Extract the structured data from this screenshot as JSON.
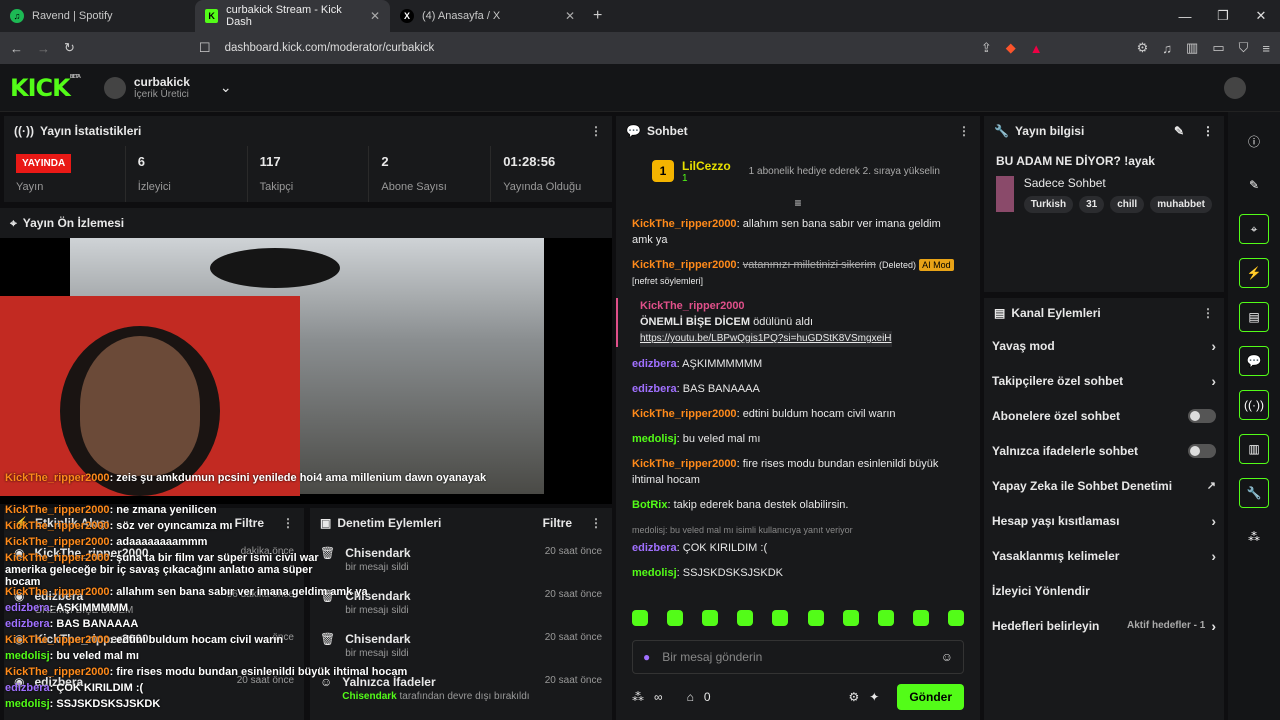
{
  "browser": {
    "tabs": [
      {
        "title": "Ravend | Spotify",
        "icon": "spotify-icon"
      },
      {
        "title": "curbakick Stream - Kick Dash",
        "icon": "kick-icon"
      },
      {
        "title": "(4) Anasayfa / X",
        "icon": "x-icon"
      }
    ],
    "url": "dashboard.kick.com/moderator/curbakick"
  },
  "header": {
    "logo": "KICK",
    "logo_badge": "BETA",
    "channel_name": "curbakick",
    "channel_role": "İçerik Üretici"
  },
  "stats": {
    "title": "Yayın İstatistikleri",
    "live_badge": "YAYINDA",
    "live_label": "Yayın",
    "items": [
      {
        "value": "6",
        "label": "İzleyici"
      },
      {
        "value": "117",
        "label": "Takipçi"
      },
      {
        "value": "2",
        "label": "Abone Sayısı"
      },
      {
        "value": "01:28:56",
        "label": "Yayında Olduğu"
      }
    ]
  },
  "preview": {
    "title": "Yayın Ön İzlemesi",
    "overlay_chat": [
      {
        "user": "KickThe_ripper2000",
        "text": "zeis şu amkdumun pcsini yenilede hoi4 ama millenium dawn oyanayak"
      },
      {
        "user": "KickThe_ripper2000",
        "text": "ne zmana yenilicen"
      },
      {
        "user": "KickThe_ripper2000",
        "text": "söz ver oyıncamıza mı"
      },
      {
        "user": "KickThe_ripper2000",
        "text": "adaaaaaaaammm"
      },
      {
        "user": "KickThe_ripper2000",
        "text": "şuna ta bir film var süper ismi civil war amerika geleceğe bir iç savaş çıkacağını anlatıo ama süper hocam"
      },
      {
        "user": "KickThe_ripper2000",
        "text": "allahım sen bana sabır ver imana geldim amk ya"
      },
      {
        "user": "edizbera",
        "text": "AŞKIMMMMM"
      },
      {
        "user": "edizbera",
        "text": "BAS BANAAAA"
      },
      {
        "user": "KickThe_ripper2000",
        "text": "edtini buldum hocam civil warın"
      },
      {
        "user": "medolisj",
        "text": "bu veled mal mı"
      },
      {
        "user": "KickThe_ripper2000",
        "text": "fire rises modu bundan esinlenildi büyük ihtimal hocam"
      },
      {
        "user": "edizbera",
        "text": "ÇOK KIRILDIM :("
      },
      {
        "user": "medolisj",
        "text": "SSJSKDSKSJSKDK"
      }
    ]
  },
  "activity": {
    "title": "Etkinlik Akışı",
    "filter": "Filtre",
    "rows": [
      {
        "name": "KickThe_ripper2000",
        "time": "dakika önce"
      },
      {
        "name": "edizbera",
        "sub": "ÖNEMLİ BİŞE DİCEM",
        "time": "56 dakika önce"
      },
      {
        "name": "KickThe_ripper2000",
        "time": "önce"
      },
      {
        "name": "edizbera",
        "time": "20 saat önce"
      }
    ]
  },
  "moderation": {
    "title": "Denetim Eylemleri",
    "filter": "Filtre",
    "rows": [
      {
        "name": "Chisendark",
        "sub": "bir mesajı sildi",
        "time": "20 saat önce"
      },
      {
        "name": "Chisendark",
        "sub": "bir mesajı sildi",
        "time": "20 saat önce"
      },
      {
        "name": "Chisendark",
        "sub": "bir mesajı sildi",
        "time": "20 saat önce"
      },
      {
        "name": "Yalnızca İfadeler",
        "sub_user": "Chisendark",
        "sub": "tarafından devre dışı bırakıldı",
        "time": "20 saat önce"
      }
    ]
  },
  "chat": {
    "title": "Sohbet",
    "pinned_user": "LilCezzo",
    "pinned_count": "1",
    "pinned_text": "1 abonelik hediye ederek 2. sıraya yükselin",
    "messages": [
      {
        "user": "KickThe_ripper2000",
        "text": "allahım sen bana sabır ver imana geldim amk ya"
      },
      {
        "user": "KickThe_ripper2000",
        "text": "vatanınızı milletinizi sikerim",
        "deleted": "(Deleted)",
        "tag": "AI Mod",
        "reason": "[nefret söylemleri]"
      },
      {
        "user": "edizbera",
        "text": "AŞKIMMMMMM"
      },
      {
        "user": "edizbera",
        "text": "BAS BANAAAA"
      },
      {
        "user": "KickThe_ripper2000",
        "text": "edtini buldum hocam civil warın"
      },
      {
        "user": "medolisj",
        "text": "bu veled mal mı"
      },
      {
        "user": "KickThe_ripper2000",
        "text": "fire rises modu bundan esinlenildi büyük ihtimal hocam"
      },
      {
        "user": "BotRix",
        "text": "takip ederek bana destek olabilirsin."
      },
      {
        "user": "edizbera",
        "text": "ÇOK KIRILDIM :("
      },
      {
        "user": "medolisj",
        "text": "SSJSKDSKSJSKDK"
      }
    ],
    "reward_user": "KickThe_ripper2000",
    "reward_text": "ÖNEMLİ BİŞE DİCEM",
    "reward_suffix": "ödülünü aldı",
    "reward_link": "https://youtu.be/LBPwQgis1PQ?si=huGDStK8VSmgxeiH",
    "reply_hint": "medolisj: bu veled mal mı isimli kullanıcıya yanıt veriyor",
    "input_placeholder": "Bir mesaj gönderin",
    "count": "0",
    "send": "Gönder"
  },
  "stream_info": {
    "title": "Yayın bilgisi",
    "stream_title": "BU ADAM NE DİYOR? !ayak",
    "category": "Sadece Sohbet",
    "tags": [
      "Turkish",
      "31",
      "chill",
      "muhabbet"
    ]
  },
  "channel_actions": {
    "title": "Kanal Eylemleri",
    "items": [
      {
        "label": "Yavaş mod",
        "kind": "arrow"
      },
      {
        "label": "Takipçilere özel sohbet",
        "kind": "arrow"
      },
      {
        "label": "Abonelere özel sohbet",
        "kind": "toggle"
      },
      {
        "label": "Yalnızca ifadelerle sohbet",
        "kind": "toggle"
      },
      {
        "label": "Yapay Zeka ile Sohbet Denetimi",
        "kind": "link"
      },
      {
        "label": "Hesap yaşı kısıtlaması",
        "kind": "arrow"
      },
      {
        "label": "Yasaklanmış kelimeler",
        "kind": "arrow"
      },
      {
        "label": "İzleyici Yönlendir",
        "kind": "none"
      },
      {
        "label": "Hedefleri belirleyin",
        "kind": "arrow",
        "extra": "Aktif hedefler - 1"
      }
    ]
  },
  "colors": {
    "accent": "#53fc18",
    "live": "#e91916",
    "username_orange": "#ff8a1a",
    "username_purple": "#a070ff"
  }
}
